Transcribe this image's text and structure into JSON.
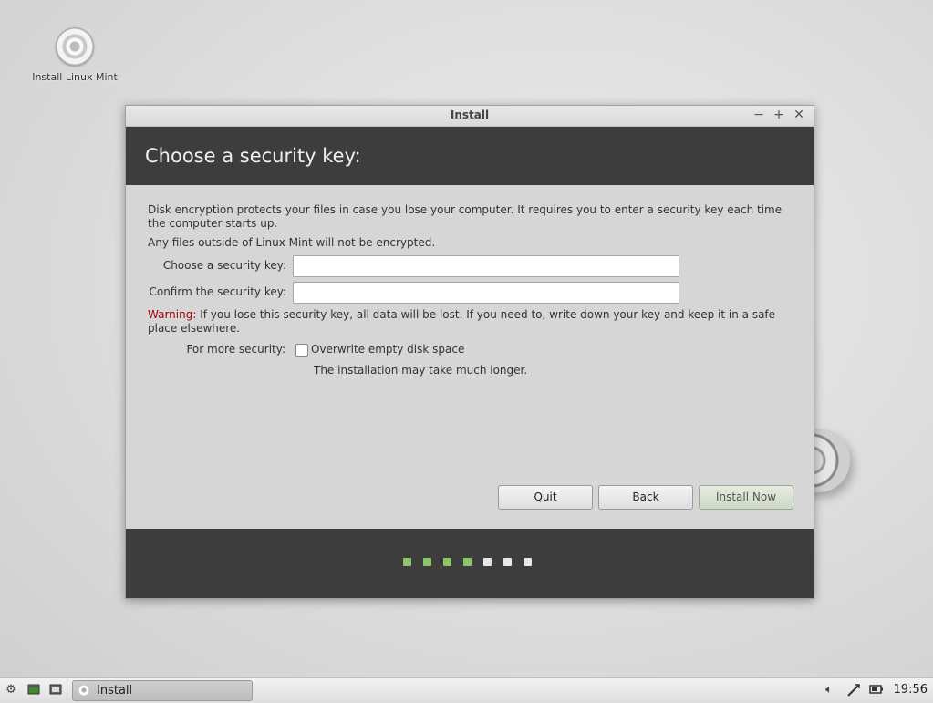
{
  "desktop": {
    "icon_label": "Install Linux Mint"
  },
  "window": {
    "title": "Install",
    "controls": {
      "minimize": "−",
      "maximize": "+",
      "close": "✕"
    },
    "heading": "Choose a security key:",
    "intro_line1": "Disk encryption protects your files in case you lose your computer. It requires you to enter a security key each time",
    "intro_line2": "the computer starts up.",
    "note": "Any files outside of Linux Mint will not be encrypted.",
    "key_label": "Choose a security key:",
    "key_value": "",
    "confirm_label": "Confirm the security key:",
    "confirm_value": "",
    "warning_prefix": "Warning:",
    "warning_line1": " If you lose this security key, all data will be lost. If you need to, write down your key and keep it in a safe",
    "warning_line2": "place elsewhere.",
    "more_security_label": "For more security:",
    "overwrite_label": "Overwrite empty disk space",
    "overwrite_checked": false,
    "overwrite_hint": "The installation may take much longer.",
    "buttons": {
      "quit": "Quit",
      "back": "Back",
      "install_now": "Install Now"
    },
    "progress": {
      "total_steps": 7,
      "completed_steps": 4,
      "done_color": "#8bc766",
      "pending_color": "#e8e8e8"
    }
  },
  "taskbar": {
    "menu_icon": "gear-icon",
    "launcher_icons": [
      "show-desktop-icon",
      "terminal-icon"
    ],
    "task_label": "Install",
    "tray_icons": [
      "volume-icon",
      "network-icon",
      "battery-icon"
    ],
    "clock": "19:56"
  }
}
